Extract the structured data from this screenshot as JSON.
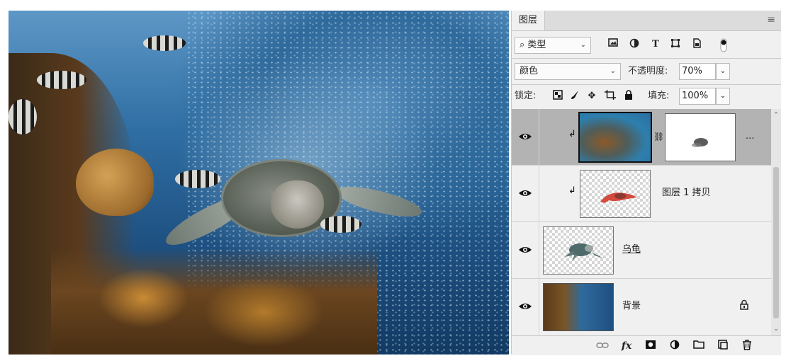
{
  "panel": {
    "tab_label": "图层",
    "menu_icon": "panel-menu-icon"
  },
  "filter": {
    "kind_label": "类型",
    "icons": [
      "image-filter-icon",
      "adjustment-filter-icon",
      "type-filter-icon",
      "shape-filter-icon",
      "smart-object-filter-icon",
      "filter-toggle-icon"
    ]
  },
  "blend": {
    "mode": "颜色",
    "opacity_label": "不透明度:",
    "opacity_value": "70%"
  },
  "lock": {
    "label": "锁定:",
    "fill_label": "填充:",
    "fill_value": "100%"
  },
  "layers": [
    {
      "name": "",
      "type": "adjustment",
      "clipped": true,
      "selected": true,
      "has_mask": true,
      "more": "..."
    },
    {
      "name": "图层 1 拷贝",
      "type": "pixel",
      "clipped": true,
      "selected": false
    },
    {
      "name": "乌龟",
      "type": "pixel",
      "clipped": false,
      "selected": false
    },
    {
      "name": "背景",
      "type": "background",
      "clipped": false,
      "selected": false,
      "locked": true
    }
  ],
  "footer": {
    "icons": [
      "link-layers-icon",
      "fx-icon",
      "add-mask-icon",
      "adjustment-layer-icon",
      "group-folder-icon",
      "new-layer-icon",
      "delete-icon"
    ],
    "fx_label": "fx"
  },
  "colors": {
    "selected_row": "#b3b3b3",
    "panel_bg": "#f0f0f0"
  }
}
